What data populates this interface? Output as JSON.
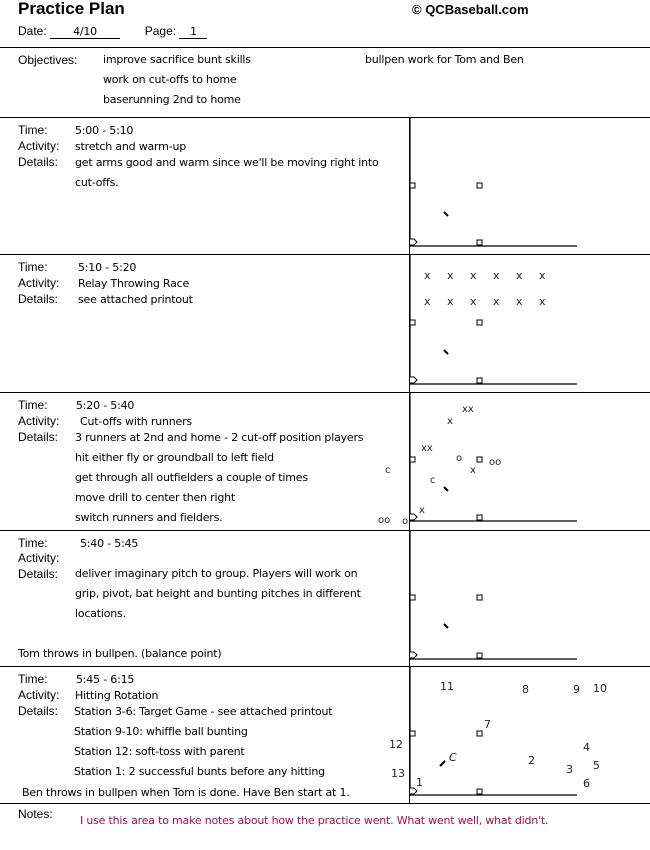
{
  "header": {
    "title": "Practice Plan",
    "copyright": "© QCBaseball.com",
    "date_label": "Date:",
    "date_value": "4/10",
    "page_label": "Page:",
    "page_value": "1"
  },
  "objectives": {
    "label": "Objectives:",
    "items": [
      "improve sacrifice bunt skills",
      "work on cut-offs to home",
      "baserunning 2nd to home"
    ],
    "side_item": "bullpen work for Tom and Ben"
  },
  "labels": {
    "time": "Time:",
    "activity": "Activity:",
    "details": "Details:",
    "notes": "Notes:"
  },
  "blocks": [
    {
      "time": "5:00  -  5:10",
      "activity": "stretch and warm-up",
      "details": [
        "get arms good and warm since we'll be moving right into",
        "cut-offs."
      ],
      "footer": "",
      "diagram_marks": []
    },
    {
      "time": "5:10  -  5:20",
      "activity": "Relay Throwing Race",
      "details": [
        "see attached printout"
      ],
      "footer": "",
      "diagram_marks": [
        "x",
        "x",
        "x",
        "x",
        "x",
        "x",
        "x",
        "x",
        "x",
        "x",
        "x",
        "x"
      ]
    },
    {
      "time": "5:20 -  5:40",
      "activity": "Cut-offs with runners",
      "details": [
        "3 runners at 2nd and home - 2 cut-off position players",
        "hit either fly or groundball to left field",
        "get through all outfielders a couple of times",
        "move drill to center then right",
        "switch runners and fielders."
      ],
      "footer": "",
      "diagram_marks": [
        "xx",
        "x",
        "xx",
        "o",
        "oo",
        "x",
        "c",
        "c",
        "x",
        "oo",
        "o"
      ]
    },
    {
      "time": "5:40 -  5:45",
      "activity": "",
      "details": [
        "deliver imaginary pitch to group.  Players will work on",
        "grip, pivot, bat height and bunting pitches in different",
        "locations."
      ],
      "footer": "Tom throws in bullpen.  (balance point)",
      "diagram_marks": []
    },
    {
      "time": "5:45 -  6:15",
      "activity": "Hitting Rotation",
      "details": [
        "Station 3-6: Target Game - see attached printout",
        "Station 9-10: whiffle ball bunting",
        "Station 12: soft-toss with parent",
        "Station 1: 2 successful bunts before any hitting"
      ],
      "footer": "Ben throws in bullpen when Tom is done.  Have Ben start at 1.",
      "diagram_marks": [
        "11",
        "8",
        "9",
        "10",
        "7",
        "12",
        "C",
        "2",
        "4",
        "5",
        "3",
        "13",
        "1",
        "6"
      ]
    }
  ],
  "notes": {
    "text": "I use this area to make notes about how the practice went.  What went well, what didn't.",
    "color": "#a0104a"
  }
}
